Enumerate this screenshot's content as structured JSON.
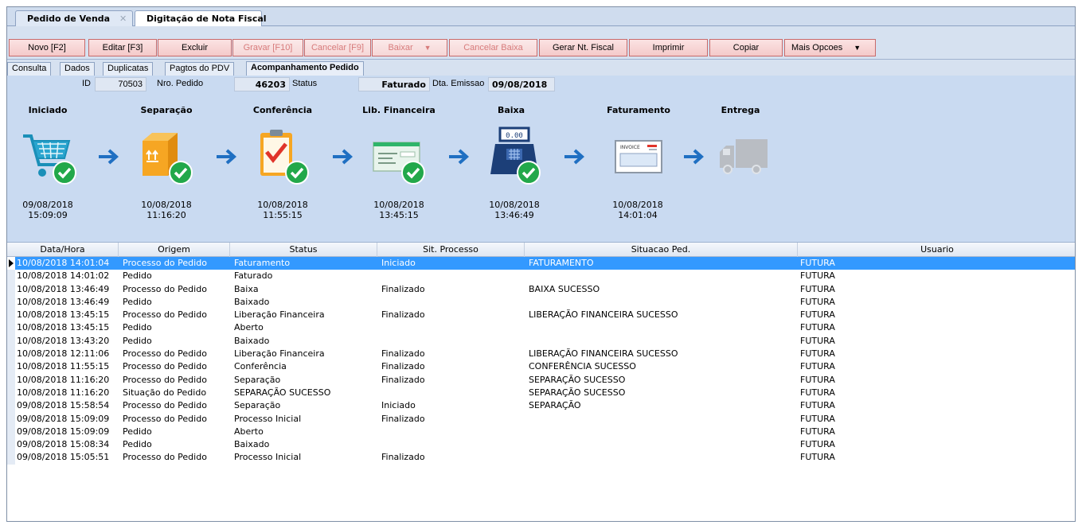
{
  "doc_tabs": [
    {
      "label": "Pedido de Venda",
      "closable": true
    },
    {
      "label": "Digitação de Nota Fiscal",
      "closable": false
    }
  ],
  "toolbar": {
    "novo": "Novo [F2]",
    "editar": "Editar [F3]",
    "excluir": "Excluir",
    "gravar": "Gravar [F10]",
    "cancelar": "Cancelar [F9]",
    "baixar": "Baixar",
    "cancelar_baixa": "Cancelar Baixa",
    "gerar_nf": "Gerar Nt. Fiscal",
    "imprimir": "Imprimir",
    "copiar": "Copiar",
    "mais_opcoes": "Mais Opcoes"
  },
  "sub_tabs": [
    "Consulta",
    "Dados",
    "Duplicatas",
    "Pagtos do PDV",
    "Acompanhamento Pedido"
  ],
  "info": {
    "id_label": "ID",
    "id_value": "70503",
    "nro_pedido_label": "Nro. Pedido",
    "nro_pedido_value": "46203",
    "status_label": "Status",
    "status_value": "Faturado",
    "dta_emissao_label": "Dta. Emissao",
    "dta_emissao_value": "09/08/2018"
  },
  "stages": [
    {
      "title": "Iniciado",
      "date": "09/08/2018",
      "time": "15:09:09",
      "icon": "cart-check-icon"
    },
    {
      "title": "Separação",
      "date": "10/08/2018",
      "time": "11:16:20",
      "icon": "box-check-icon"
    },
    {
      "title": "Conferência",
      "date": "10/08/2018",
      "time": "11:55:15",
      "icon": "clipboard-check-icon"
    },
    {
      "title": "Lib. Financeira",
      "date": "10/08/2018",
      "time": "13:45:15",
      "icon": "cheque-check-icon"
    },
    {
      "title": "Baixa",
      "date": "10/08/2018",
      "time": "13:46:49",
      "icon": "register-check-icon"
    },
    {
      "title": "Faturamento",
      "date": "10/08/2018",
      "time": "14:01:04",
      "icon": "invoice-icon"
    },
    {
      "title": "Entrega",
      "date": "",
      "time": "",
      "icon": "truck-icon"
    }
  ],
  "invoice_icon_text": "INVOICE",
  "register_display": "0.00",
  "grid": {
    "columns": [
      "Data/Hora",
      "Origem",
      "Status",
      "Sit. Processo",
      "Situacao Ped.",
      "Usuario"
    ],
    "rows": [
      [
        "10/08/2018 14:01:04",
        "Processo do Pedido",
        "Faturamento",
        "Iniciado",
        "FATURAMENTO",
        "FUTURA"
      ],
      [
        "10/08/2018 14:01:02",
        "Pedido",
        "Faturado",
        "",
        "",
        "FUTURA"
      ],
      [
        "10/08/2018 13:46:49",
        "Processo do Pedido",
        "Baixa",
        "Finalizado",
        "BAIXA SUCESSO",
        "FUTURA"
      ],
      [
        "10/08/2018 13:46:49",
        "Pedido",
        "Baixado",
        "",
        "",
        "FUTURA"
      ],
      [
        "10/08/2018 13:45:15",
        "Processo do Pedido",
        "Liberação Financeira",
        "Finalizado",
        "LIBERAÇÃO FINANCEIRA SUCESSO",
        "FUTURA"
      ],
      [
        "10/08/2018 13:45:15",
        "Pedido",
        "Aberto",
        "",
        "",
        "FUTURA"
      ],
      [
        "10/08/2018 13:43:20",
        "Pedido",
        "Baixado",
        "",
        "",
        "FUTURA"
      ],
      [
        "10/08/2018 12:11:06",
        "Processo do Pedido",
        "Liberação Financeira",
        "Finalizado",
        "LIBERAÇÃO FINANCEIRA SUCESSO",
        "FUTURA"
      ],
      [
        "10/08/2018 11:55:15",
        "Processo do Pedido",
        "Conferência",
        "Finalizado",
        "CONFERÊNCIA SUCESSO",
        "FUTURA"
      ],
      [
        "10/08/2018 11:16:20",
        "Processo do Pedido",
        "Separação",
        "Finalizado",
        "SEPARAÇÃO SUCESSO",
        "FUTURA"
      ],
      [
        "10/08/2018 11:16:20",
        "Situação do Pedido",
        "SEPARAÇÃO SUCESSO",
        "",
        "SEPARAÇÃO SUCESSO",
        "FUTURA"
      ],
      [
        "09/08/2018 15:58:54",
        "Processo do Pedido",
        "Separação",
        "Iniciado",
        "SEPARAÇÃO",
        "FUTURA"
      ],
      [
        "09/08/2018 15:09:09",
        "Processo do Pedido",
        "Processo Inicial",
        "Finalizado",
        "",
        "FUTURA"
      ],
      [
        "09/08/2018 15:09:09",
        "Pedido",
        "Aberto",
        "",
        "",
        "FUTURA"
      ],
      [
        "09/08/2018 15:08:34",
        "Pedido",
        "Baixado",
        "",
        "",
        "FUTURA"
      ],
      [
        "09/08/2018 15:05:51",
        "Processo do Pedido",
        "Processo Inicial",
        "Finalizado",
        "",
        "FUTURA"
      ]
    ],
    "selected_row": 0
  },
  "colors": {
    "selection": "#3399ff",
    "panel": "#c9daf1",
    "check_green": "#22a84a",
    "arrow_blue": "#1f6fc2"
  }
}
